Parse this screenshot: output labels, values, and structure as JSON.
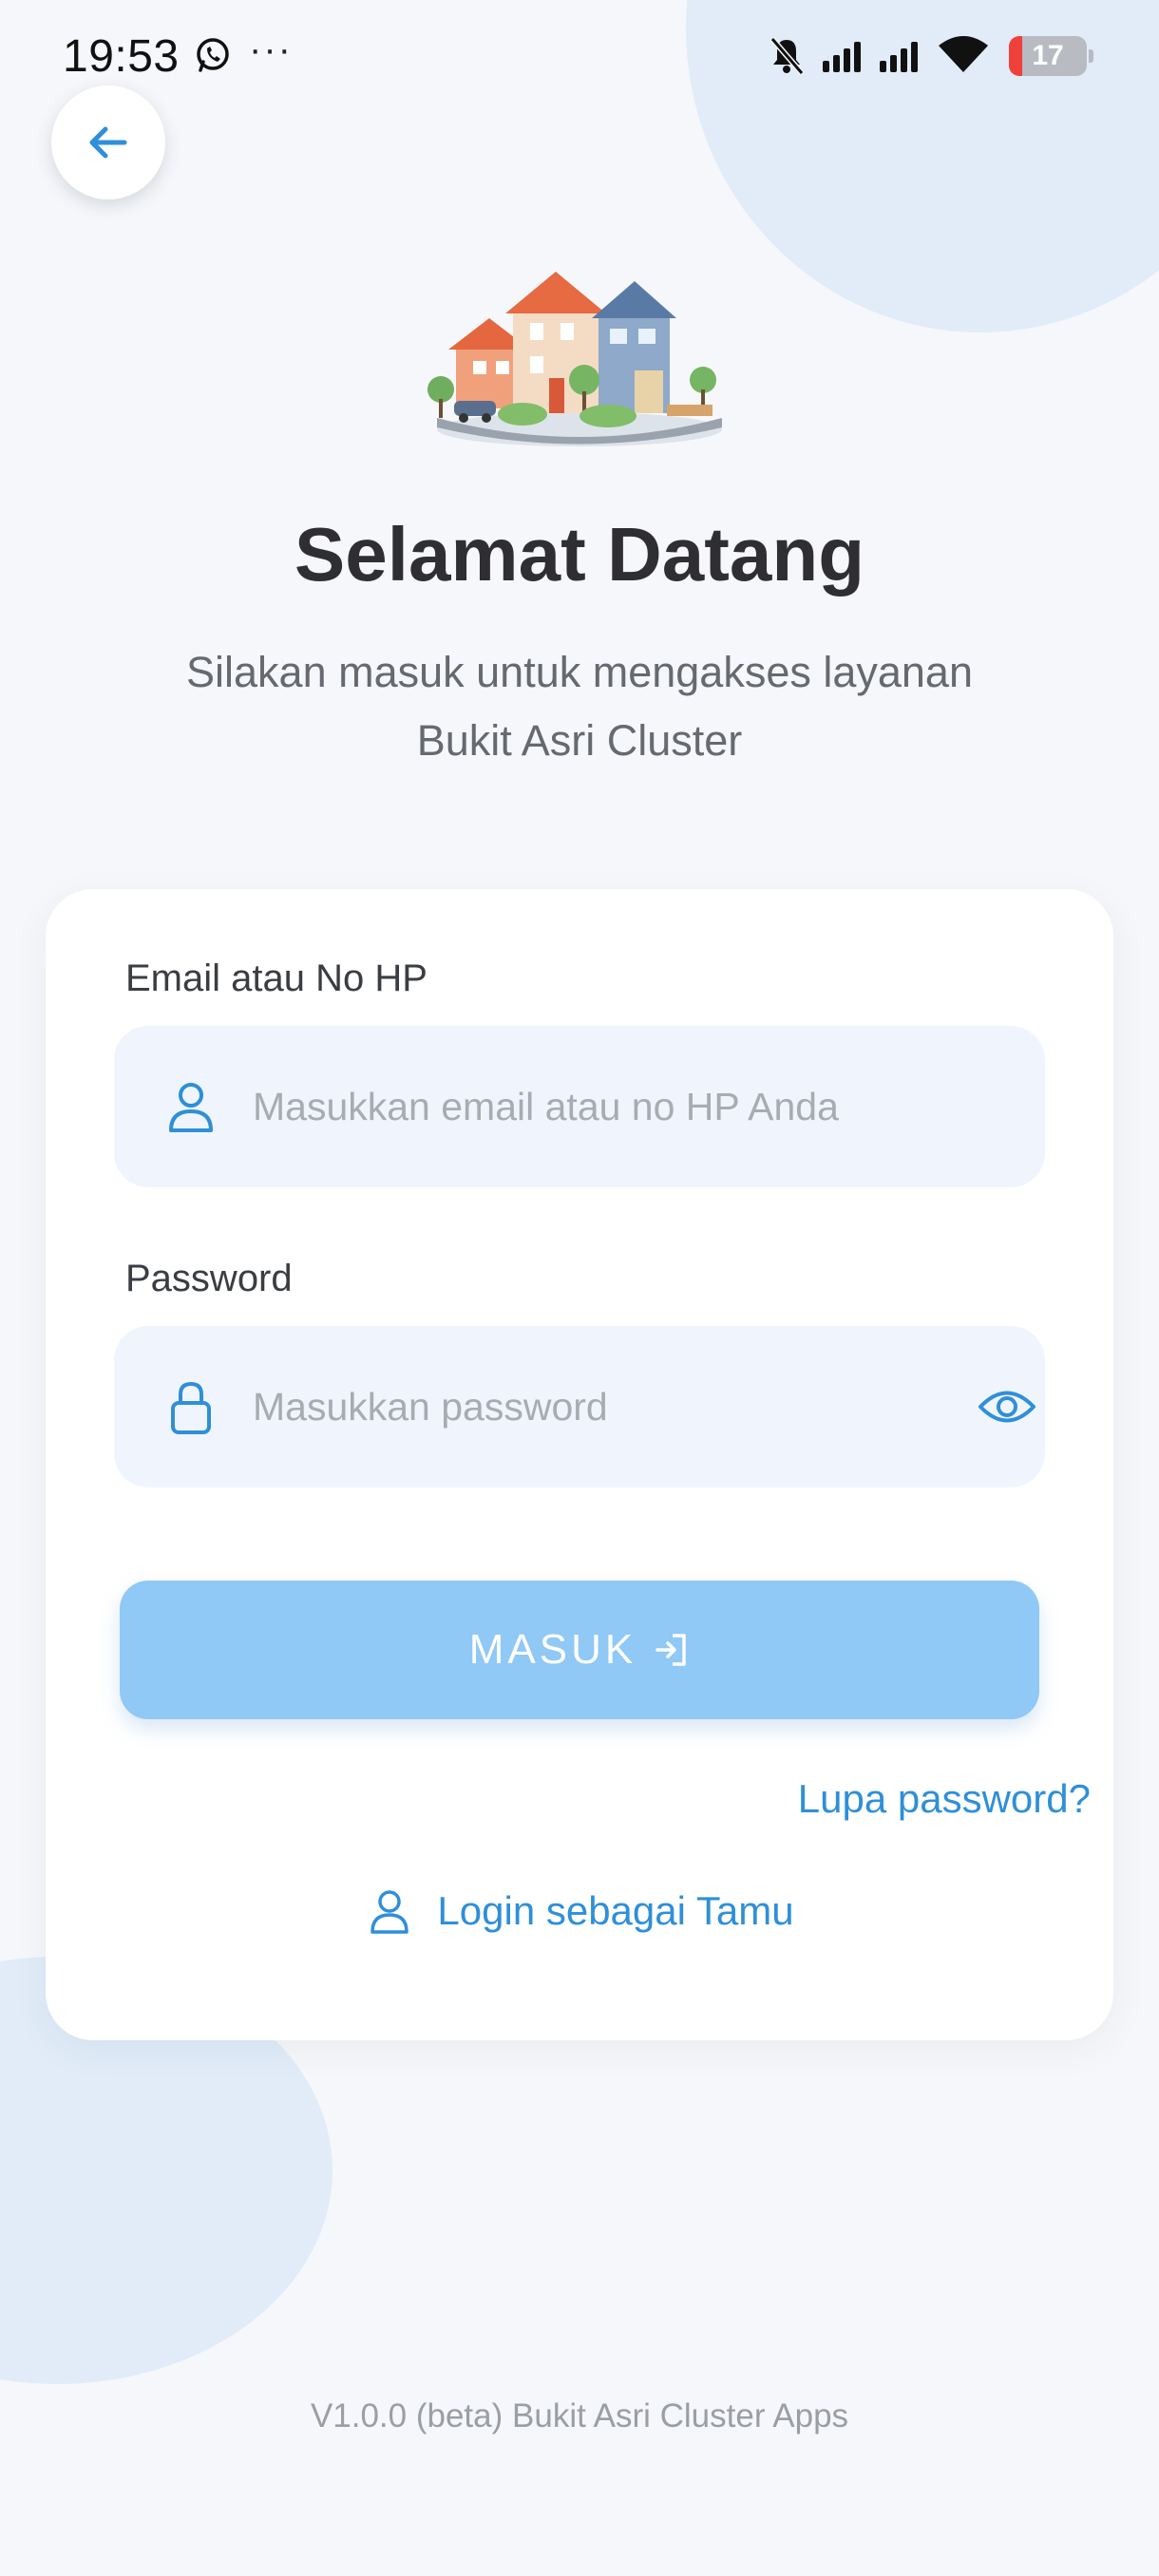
{
  "status_bar": {
    "time": "19:53",
    "more": "···",
    "battery_level": "17",
    "battery_fraction": 0.17
  },
  "icons": {
    "back": "arrow-left-icon",
    "email_field": "user-icon",
    "password_field": "lock-icon",
    "toggle_password": "eye-icon",
    "submit": "login-icon",
    "guest": "user-icon"
  },
  "header": {
    "title": "Selamat Datang",
    "subtitle": "Silakan masuk untuk mengakses layanan Bukit Asri Cluster"
  },
  "form": {
    "email_label": "Email atau No HP",
    "email_placeholder": "Masukkan email atau no HP Anda",
    "email_value": "",
    "password_label": "Password",
    "password_placeholder": "Masukkan password",
    "password_value": "",
    "submit_label": "MASUK",
    "forgot_label": "Lupa password?",
    "guest_label": "Login sebagai Tamu"
  },
  "footer": {
    "version": "V1.0.0 (beta) Bukit Asri Cluster Apps"
  },
  "colors": {
    "accent": "#2f8fd8",
    "button_disabled": "#90c8f6",
    "input_bg": "#f0f5fd",
    "background": "#f6f7fa",
    "decor_circle": "#e1ecf8"
  }
}
